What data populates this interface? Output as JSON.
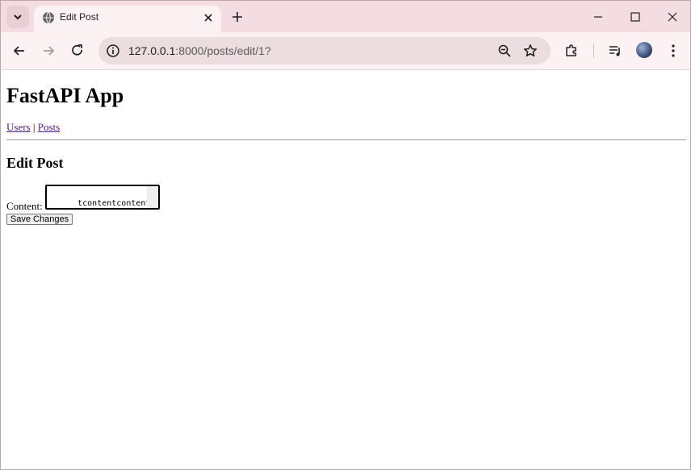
{
  "browser": {
    "tab": {
      "title": "Edit Post"
    },
    "address_bar": {
      "host": "127.0.0.1",
      "rest": ":8000/posts/edit/1?"
    }
  },
  "page": {
    "app_title": "FastAPI App",
    "nav": {
      "users_link": "Users",
      "separator": "|",
      "posts_link": "Posts"
    },
    "heading": "Edit Post",
    "form": {
      "content_label": "Content:",
      "content_value": "tcontentcontentconte\nntcontent",
      "submit_label": "Save Changes"
    }
  },
  "icons": [
    "tab-search-icon",
    "globe-icon",
    "close-icon",
    "plus-icon",
    "minimize-icon",
    "maximize-icon",
    "window-close-icon",
    "back-arrow-icon",
    "forward-arrow-icon",
    "reload-icon",
    "site-info-icon",
    "zoom-out-icon",
    "star-icon",
    "extensions-icon",
    "media-controls-icon",
    "more-vert-icon"
  ],
  "colors": {
    "tabstrip_bg": "#f3dde2",
    "toolbar_bg": "#fcf2f4",
    "omnibox_bg": "#ecdde1",
    "visited_link": "#551a8b"
  }
}
